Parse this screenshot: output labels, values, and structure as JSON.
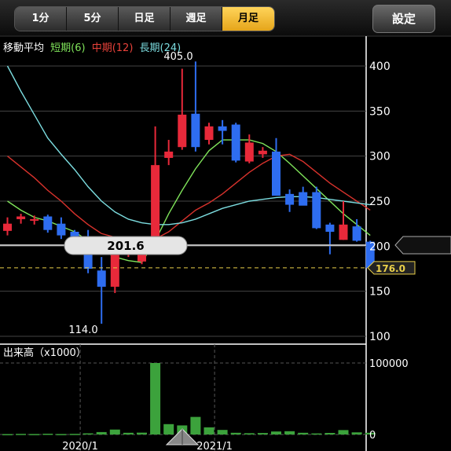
{
  "toolbar": {
    "tabs": [
      {
        "label": "1分",
        "active": false
      },
      {
        "label": "5分",
        "active": false
      },
      {
        "label": "日足",
        "active": false
      },
      {
        "label": "週足",
        "active": false
      },
      {
        "label": "月足",
        "active": true
      }
    ],
    "settings_label": "設定"
  },
  "moving_average": {
    "title": "移動平均",
    "short": "短期(6)",
    "mid": "中期(12)",
    "long": "長期(24)"
  },
  "volume_panel": {
    "title": "出来高（x1000）"
  },
  "colors": {
    "up": "#e8293a",
    "down": "#2e6df0",
    "ma_short": "#7fe35a",
    "ma_mid": "#d8322c",
    "ma_long": "#7cdde0",
    "volume": "#3ca23c",
    "current_price": "#e9cf49",
    "tab_active": "#f2bb33"
  },
  "chart_data": [
    {
      "type": "candlestick",
      "ylim": [
        90,
        430
      ],
      "y_ticks": [
        "100",
        "150",
        "200",
        "250",
        "300",
        "350",
        "400"
      ],
      "x_labels": [
        "2020/1",
        "2021/1"
      ],
      "high_label": "405.0",
      "low_label": "114.0",
      "crosshair_price": "201.6",
      "current_price": "176.0",
      "candles": [
        {
          "o": 217,
          "h": 232,
          "l": 212,
          "c": 225
        },
        {
          "o": 230,
          "h": 236,
          "l": 225,
          "c": 233
        },
        {
          "o": 230,
          "h": 234,
          "l": 224,
          "c": 230
        },
        {
          "o": 233,
          "h": 235,
          "l": 215,
          "c": 218
        },
        {
          "o": 225,
          "h": 232,
          "l": 208,
          "c": 212
        },
        {
          "o": 216,
          "h": 218,
          "l": 207,
          "c": 208
        },
        {
          "o": 200,
          "h": 218,
          "l": 170,
          "c": 175
        },
        {
          "o": 173,
          "h": 188,
          "l": 114,
          "c": 155
        },
        {
          "o": 155,
          "h": 195,
          "l": 148,
          "c": 193
        },
        {
          "o": 191,
          "h": 198,
          "l": 188,
          "c": 193
        },
        {
          "o": 183,
          "h": 207,
          "l": 180,
          "c": 203
        },
        {
          "o": 203,
          "h": 333,
          "l": 203,
          "c": 290
        },
        {
          "o": 298,
          "h": 318,
          "l": 290,
          "c": 305
        },
        {
          "o": 310,
          "h": 397,
          "l": 307,
          "c": 346
        },
        {
          "o": 347,
          "h": 405,
          "l": 305,
          "c": 310
        },
        {
          "o": 318,
          "h": 337,
          "l": 313,
          "c": 333
        },
        {
          "o": 333,
          "h": 340,
          "l": 313,
          "c": 328
        },
        {
          "o": 335,
          "h": 337,
          "l": 293,
          "c": 295
        },
        {
          "o": 294,
          "h": 324,
          "l": 292,
          "c": 315
        },
        {
          "o": 302,
          "h": 310,
          "l": 298,
          "c": 306
        },
        {
          "o": 305,
          "h": 320,
          "l": 270,
          "c": 256
        },
        {
          "o": 258,
          "h": 263,
          "l": 238,
          "c": 246
        },
        {
          "o": 260,
          "h": 266,
          "l": 249,
          "c": 245
        },
        {
          "o": 260,
          "h": 266,
          "l": 219,
          "c": 220
        },
        {
          "o": 224,
          "h": 226,
          "l": 191,
          "c": 216
        },
        {
          "o": 207,
          "h": 250,
          "l": 207,
          "c": 224
        },
        {
          "o": 222,
          "h": 230,
          "l": 205,
          "c": 206
        },
        {
          "o": 205,
          "h": 206,
          "l": 174,
          "c": 176
        }
      ],
      "ma_short": [
        250,
        240,
        232,
        228,
        222,
        216,
        206,
        196,
        188,
        184,
        182,
        206,
        236,
        262,
        286,
        306,
        318,
        318,
        318,
        314,
        305,
        292,
        278,
        264,
        250,
        236,
        224,
        212
      ],
      "ma_mid": [
        300,
        288,
        276,
        262,
        250,
        236,
        224,
        214,
        210,
        206,
        202,
        208,
        216,
        228,
        240,
        248,
        258,
        270,
        282,
        292,
        300,
        302,
        294,
        282,
        270,
        260,
        250,
        240
      ],
      "ma_long": [
        400,
        372,
        346,
        320,
        302,
        285,
        266,
        250,
        238,
        230,
        226,
        224,
        224,
        226,
        230,
        236,
        242,
        246,
        250,
        252,
        254,
        255,
        255,
        254,
        252,
        250,
        248,
        246
      ]
    },
    {
      "type": "bar",
      "ylim": [
        0,
        100000
      ],
      "y_ticks": [
        "0",
        "100000"
      ],
      "values": [
        600,
        900,
        700,
        1100,
        700,
        900,
        1600,
        3400,
        6900,
        2400,
        2600,
        100000,
        14500,
        12700,
        24600,
        10000,
        6400,
        2400,
        1800,
        2100,
        4200,
        4600,
        2400,
        1500,
        2200,
        6200,
        3000,
        2400
      ]
    }
  ]
}
